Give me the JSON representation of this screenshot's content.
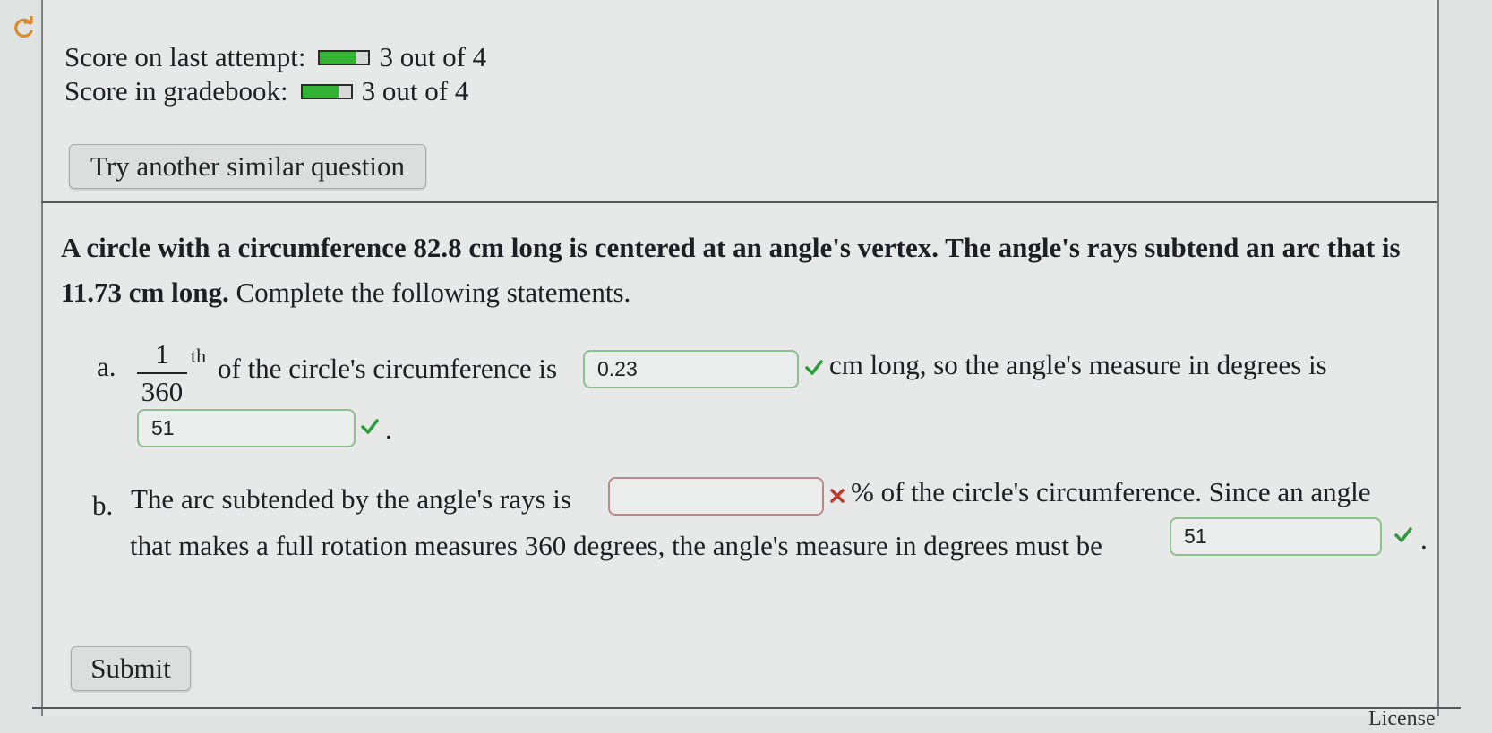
{
  "score_last": {
    "label": "Score on last attempt:",
    "value": "3 out of 4",
    "fraction": 0.75
  },
  "score_gradebook": {
    "label": "Score in gradebook:",
    "value": "3 out of 4",
    "fraction": 0.75
  },
  "try_another_label": "Try another similar question",
  "question": {
    "bold_1": "A circle with a circumference 82.8 cm long is centered at an angle's vertex. The angle's rays subtend an arc that is 11.73 cm long.",
    "normal_1": " Complete the following statements."
  },
  "part_a": {
    "marker": "a.",
    "frac_num": "1",
    "frac_den": "360",
    "sup": "th",
    "text_1": "of the circle's circumference is",
    "answer_1": "0.23",
    "text_2": "cm long, so the angle's measure in degrees is",
    "answer_2": "51",
    "end": "."
  },
  "part_b": {
    "marker": "b.",
    "text_1": "The arc subtended by the angle's rays is",
    "answer_1": "",
    "text_2": "% of the circle's circumference. Since an angle",
    "text_3": "that makes a full rotation measures 360 degrees, the angle's measure in degrees must be",
    "answer_2": "51",
    "end": "."
  },
  "submit_label": "Submit",
  "license_label": "License",
  "colors": {
    "correct": "#2e9b3a",
    "wrong": "#c0392b",
    "score_fill": "#34b233"
  },
  "icons": {
    "reload": "reload-icon",
    "correct": "check-icon",
    "wrong": "x-icon"
  }
}
